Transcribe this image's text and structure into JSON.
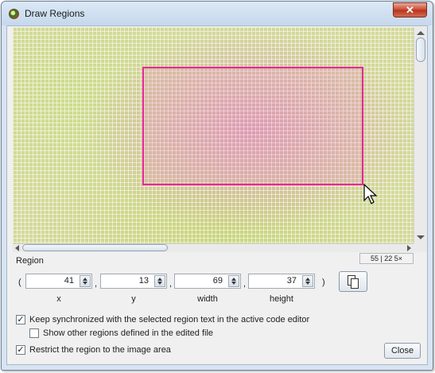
{
  "window": {
    "title": "Draw Regions",
    "close_glyph": "✕"
  },
  "status": {
    "text": "55 | 22  5×"
  },
  "region": {
    "label": "Region",
    "open_paren": "(",
    "close_paren": ")",
    "separator": ",",
    "fields": [
      {
        "caption": "x",
        "value": "41"
      },
      {
        "caption": "y",
        "value": "13"
      },
      {
        "caption": "width",
        "value": "69"
      },
      {
        "caption": "height",
        "value": "37"
      }
    ]
  },
  "options": {
    "keep_sync": {
      "label": "Keep synchronized with the selected region text in the active code editor",
      "checked": true
    },
    "show_other": {
      "label": "Show other regions defined in the edited file",
      "checked": false
    },
    "restrict": {
      "label": "Restrict the region to the image area",
      "checked": true
    }
  },
  "buttons": {
    "close": "Close"
  },
  "colors": {
    "region_outline": "#e7279a",
    "window_frame": "#d7e4f2",
    "titlebar_close": "#c9472f"
  },
  "icons": {
    "app": "app-icon",
    "copy": "copy-icon",
    "cursor": "mouse-pointer-icon"
  }
}
